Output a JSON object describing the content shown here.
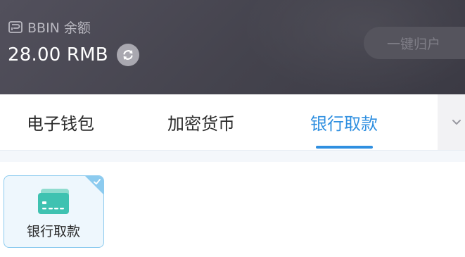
{
  "header": {
    "balance_label": "BBIN 余额",
    "balance_amount": "28.00 RMB",
    "recall_button": "一键归户"
  },
  "tabs": [
    {
      "label": "电子钱包",
      "active": false
    },
    {
      "label": "加密货币",
      "active": false
    },
    {
      "label": "银行取款",
      "active": true
    }
  ],
  "payment_methods": [
    {
      "label": "银行取款",
      "selected": true,
      "icon": "bank-card-icon"
    }
  ],
  "colors": {
    "accent": "#2f8fe0",
    "header_bg": "#46454f",
    "card_border": "#8ccbef",
    "card_icon": "#3fc2b1"
  },
  "icons": {
    "wallet": "wallet-icon",
    "refresh": "refresh-icon",
    "more": "chevron-down-icon",
    "check": "check-icon"
  }
}
